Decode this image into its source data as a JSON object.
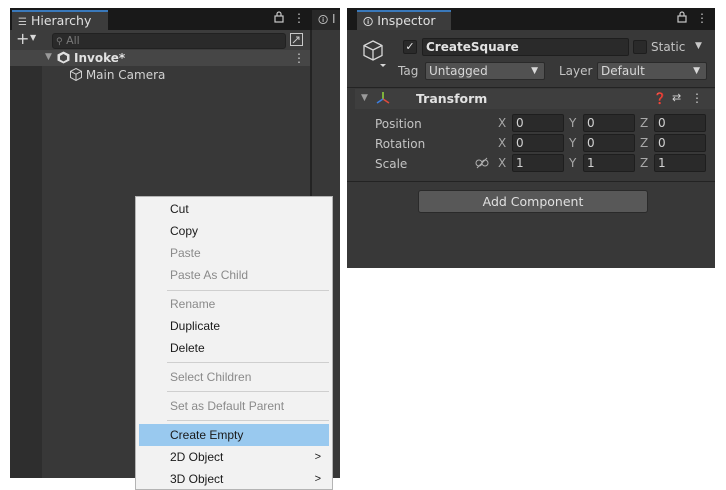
{
  "hierarchy": {
    "tab_label": "Hierarchy",
    "next_tab_label": "I",
    "search_placeholder": "All",
    "scene_name": "Invoke*",
    "items": [
      {
        "label": "Main Camera"
      }
    ]
  },
  "context_menu": {
    "items": [
      {
        "label": "Cut",
        "enabled": true
      },
      {
        "label": "Copy",
        "enabled": true
      },
      {
        "label": "Paste",
        "enabled": false
      },
      {
        "label": "Paste As Child",
        "enabled": false
      },
      {
        "label": "Rename",
        "enabled": false
      },
      {
        "label": "Duplicate",
        "enabled": true
      },
      {
        "label": "Delete",
        "enabled": true
      },
      {
        "label": "Select Children",
        "enabled": false
      },
      {
        "label": "Set as Default Parent",
        "enabled": false
      },
      {
        "label": "Create Empty",
        "enabled": true,
        "highlighted": true
      },
      {
        "label": "2D Object",
        "enabled": true,
        "submenu": true
      },
      {
        "label": "3D Object",
        "enabled": true,
        "submenu": true
      }
    ]
  },
  "inspector": {
    "tab_label": "Inspector",
    "object_name": "CreateSquare",
    "active_checked": true,
    "static_label": "Static",
    "tag_label": "Tag",
    "tag_value": "Untagged",
    "layer_label": "Layer",
    "layer_value": "Default",
    "component_title": "Transform",
    "rows": [
      {
        "label": "Position",
        "x": "0",
        "y": "0",
        "z": "0"
      },
      {
        "label": "Rotation",
        "x": "0",
        "y": "0",
        "z": "0"
      },
      {
        "label": "Scale",
        "x": "1",
        "y": "1",
        "z": "1"
      }
    ],
    "axis_labels": {
      "x": "X",
      "y": "Y",
      "z": "Z"
    },
    "add_component_label": "Add Component"
  },
  "colors": {
    "accent_tab": "#3a79bb",
    "menu_highlight": "#99c9ef",
    "panel_bg": "#383838"
  }
}
